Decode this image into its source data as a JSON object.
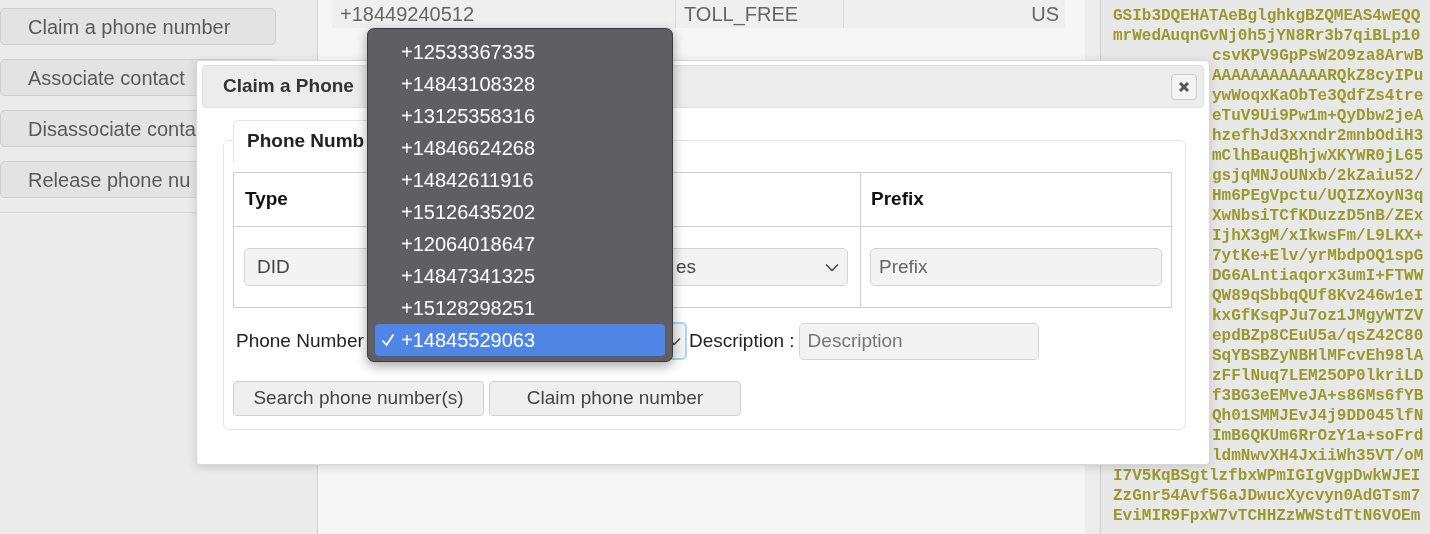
{
  "sidebar": {
    "buttons": [
      "Claim a phone number",
      "Associate contact",
      "Disassociate conta",
      "Release phone nu"
    ]
  },
  "numbers_table": {
    "rows": [
      {
        "number": "+18449240512",
        "type": "TOLL_FREE",
        "country": "US"
      }
    ]
  },
  "code_panel": {
    "lines": [
      {
        "text": "GSIb3DQEHATAeBglghkgBZQMEAS4wEQQ",
        "partial": false
      },
      {
        "text": "mrWedAuqnGvNj0h5jYN8Rr3b7qiBLp10",
        "partial": false
      },
      {
        "text": "csvKPV9GpPsW2O9za8ArwB",
        "partial": true
      },
      {
        "text": "AAAAAAAAAAAARQkZ8cyIPu",
        "partial": true
      },
      {
        "text": "ywWoqxKaObTe3QdfZs4tre",
        "partial": true
      },
      {
        "text": "eTuV9Ui9Pw1m+QyDbw2jeA",
        "partial": true
      },
      {
        "text": "hzefhJd3xxndr2mnbOdiH3",
        "partial": true
      },
      {
        "text": "mClhBauQBhjwXKYWR0jL65",
        "partial": true
      },
      {
        "text": "gsjqMNJoUNxb/2kZaiu52/",
        "partial": true
      },
      {
        "text": "Hm6PEgVpctu/UQIZXoyN3q",
        "partial": true
      },
      {
        "text": "XwNbsiTCfKDuzzD5nB/ZEx",
        "partial": true
      },
      {
        "text": "IjhX3gM/xIkwsFm/L9LKX+",
        "partial": true
      },
      {
        "text": "7ytKe+Elv/yrMbdpOQ1spG",
        "partial": true
      },
      {
        "text": "DG6ALntiaqorx3umI+FTWW",
        "partial": true
      },
      {
        "text": "QW89qSbbqQUf8Kv246w1eI",
        "partial": true
      },
      {
        "text": "kxGfKsqPJu7oz1JMgyWTZV",
        "partial": true
      },
      {
        "text": "epdBZp8CEuU5a/qsZ42C80",
        "partial": true
      },
      {
        "text": "SqYBSBZyNBHlMFcvEh98lA",
        "partial": true
      },
      {
        "text": "zFFlNuq7LEM25OP0lkriLD",
        "partial": true
      },
      {
        "text": "f3BG3eEMveJA+s86Ms6fYB",
        "partial": true
      },
      {
        "text": "Qh01SMMJEvJ4j9DD045lfN",
        "partial": true
      },
      {
        "text": "ImB6QKUm6RrOzY1a+soFrd",
        "partial": true
      },
      {
        "text": "ldmNwvXH4JxiiWh35VT/oM",
        "partial": true
      },
      {
        "text": "I7V5KqBSgtlzfbxWPmIGIgVgpDwkWJEI",
        "partial": false
      },
      {
        "text": "ZzGnr54Avf56aJDwucXycvyn0AdGTsm7",
        "partial": false
      },
      {
        "text": "EviMIR9FpxW7vTCHHZzWWStdTtN6VOEm",
        "partial": false
      }
    ]
  },
  "dialog": {
    "title": "Claim a Phone",
    "tabs": [
      {
        "label": "Phone Numb",
        "selected": true
      }
    ],
    "filter_table": {
      "type_header": "Type",
      "prefix_header": "Prefix",
      "type_value": "DID",
      "column_2_value": "es",
      "prefix_placeholder": "Prefix"
    },
    "phone_number_label": "Phone Number",
    "description_label": "Description :",
    "description_placeholder": "Description",
    "buttons": [
      "Search phone number(s)",
      "Claim phone number"
    ]
  },
  "dropdown": {
    "options": [
      {
        "label": "+12533367335",
        "selected": false
      },
      {
        "label": "+14843108328",
        "selected": false
      },
      {
        "label": "+13125358316",
        "selected": false
      },
      {
        "label": "+14846624268",
        "selected": false
      },
      {
        "label": "+14842611916",
        "selected": false
      },
      {
        "label": "+15126435202",
        "selected": false
      },
      {
        "label": "+12064018647",
        "selected": false
      },
      {
        "label": "+14847341325",
        "selected": false
      },
      {
        "label": "+15128298251",
        "selected": false
      },
      {
        "label": "+14845529063",
        "selected": true
      }
    ]
  }
}
